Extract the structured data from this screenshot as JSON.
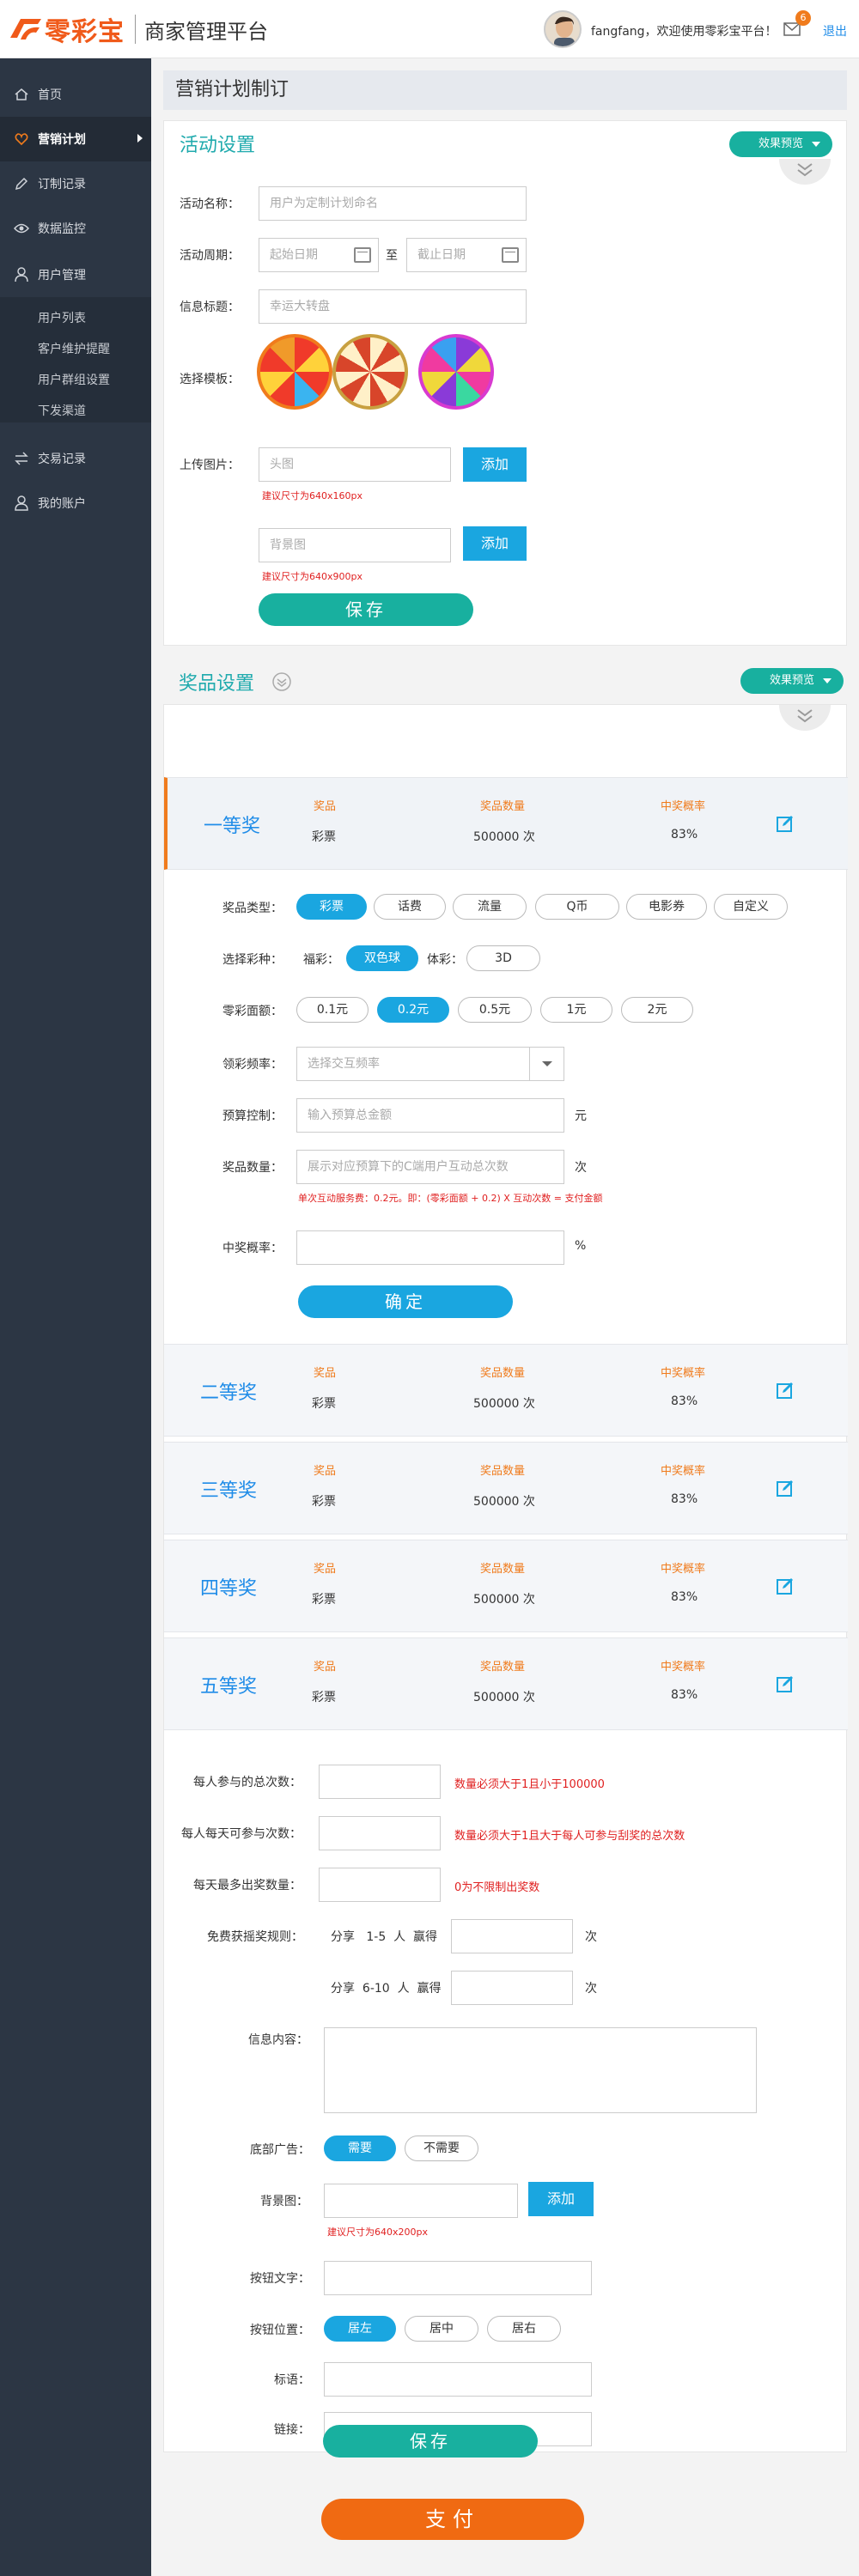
{
  "header": {
    "logo_text": "零彩宝",
    "platform_title": "商家管理平台",
    "welcome_text": "fangfang，欢迎使用零彩宝平台！",
    "message_count": "6",
    "logout_label": "退出"
  },
  "sidebar": {
    "items": [
      {
        "label": "首页",
        "icon": "home-icon"
      },
      {
        "label": "营销计划",
        "icon": "heart-icon"
      },
      {
        "label": "订制记录",
        "icon": "pencil-icon"
      },
      {
        "label": "数据监控",
        "icon": "eye-icon"
      },
      {
        "label": "用户管理",
        "icon": "user-icon"
      },
      {
        "label": "交易记录",
        "icon": "exchange-icon"
      },
      {
        "label": "我的账户",
        "icon": "person-icon"
      }
    ],
    "sub_items": [
      "用户列表",
      "客户维护提醒",
      "用户群组设置",
      "下发渠道"
    ]
  },
  "page_title": "营销计划制订",
  "activity": {
    "title": "活动设置",
    "preview_label": "效果预览",
    "name_label": "活动名称：",
    "name_placeholder": "用户为定制计划命名",
    "period_label": "活动周期：",
    "start_placeholder": "起始日期",
    "to_label": "至",
    "end_placeholder": "截止日期",
    "info_title_label": "信息标题：",
    "info_title_placeholder": "幸运大转盘",
    "template_label": "选择模板：",
    "upload_label": "上传图片：",
    "head_placeholder": "头图",
    "head_hint": "建议尺寸为640x160px",
    "bg_placeholder": "背景图",
    "bg_hint": "建议尺寸为640x900px",
    "add_label": "添加",
    "save_label": "保存"
  },
  "prize": {
    "title": "奖品设置",
    "preview_label": "效果预览",
    "col_prize": "奖品",
    "col_count": "奖品数量",
    "col_rate": "中奖概率",
    "rows": [
      {
        "name": "一等奖",
        "prize": "彩票",
        "count": "500000 次",
        "rate": "83%"
      },
      {
        "name": "二等奖",
        "prize": "彩票",
        "count": "500000 次",
        "rate": "83%"
      },
      {
        "name": "三等奖",
        "prize": "彩票",
        "count": "500000 次",
        "rate": "83%"
      },
      {
        "name": "四等奖",
        "prize": "彩票",
        "count": "500000 次",
        "rate": "83%"
      },
      {
        "name": "五等奖",
        "prize": "彩票",
        "count": "500000 次",
        "rate": "83%"
      }
    ],
    "type_label": "奖品类型：",
    "types": [
      "彩票",
      "话费",
      "流量",
      "Q币",
      "电影券",
      "自定义"
    ],
    "lottery_label": "选择彩种：",
    "welfare_label": "福彩：",
    "welfare_option": "双色球",
    "sports_label": "体彩：",
    "sports_option": "3D",
    "face_label": "零彩面额：",
    "faces": [
      "0.1元",
      "0.2元",
      "0.5元",
      "1元",
      "2元"
    ],
    "freq_label": "领彩频率：",
    "freq_placeholder": "选择交互频率",
    "budget_label": "预算控制：",
    "budget_placeholder": "输入预算总金额",
    "budget_unit": "元",
    "count_label": "奖品数量：",
    "count_placeholder": "展示对应预算下的C端用户互动总次数",
    "count_unit": "次",
    "count_hint": "单次互动服务费：0.2元。即：(零彩面额 + 0.2) X 互动次数 = 支付金额",
    "rate_label": "中奖概率：",
    "rate_unit": "%",
    "confirm_label": "确定"
  },
  "rules": {
    "total_label": "每人参与的总次数：",
    "total_hint": "数量必须大于1且小于100000",
    "daily_label": "每人每天可参与次数：",
    "daily_hint": "数量必须大于1且大于每人可参与刮奖的总次数",
    "max_label": "每天最多出奖数量：",
    "max_hint": "0为不限制出奖数",
    "free_label": "免费获摇奖规则：",
    "share_text": "分享",
    "range1": "1-5",
    "range2": "6-10",
    "person_text": "人",
    "win_text": "赢得",
    "times_text": "次",
    "info_label": "信息内容：",
    "ad_label": "底部广告：",
    "ad_yes": "需要",
    "ad_no": "不需要",
    "bg_label": "背景图：",
    "bg_add": "添加",
    "bg_hint": "建议尺寸为640x200px",
    "btn_text_label": "按钮文字：",
    "btn_pos_label": "按钮位置：",
    "pos_options": [
      "居左",
      "居中",
      "居右"
    ],
    "slogan_label": "标语：",
    "link_label": "链接：",
    "save_label": "保存"
  },
  "pay_label": "支付",
  "colors": {
    "brand": "#f05a1a",
    "teal": "#18b09f",
    "blue": "#1aa6e0",
    "sidebar": "#2c3644"
  }
}
